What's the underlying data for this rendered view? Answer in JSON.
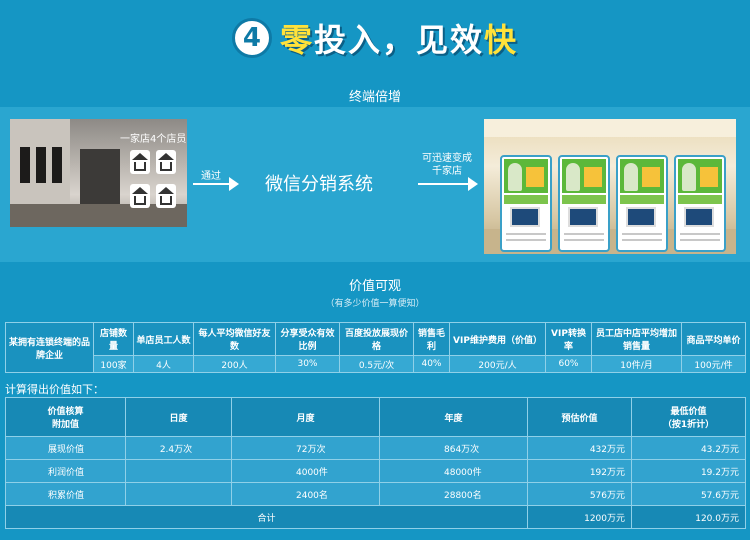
{
  "header": {
    "number": "4",
    "title_highlight": "零",
    "title_white": "投入，见效",
    "title_yellow": "快"
  },
  "sections": {
    "terminal_multiply": "终端倍增",
    "value_visible": "价值可观",
    "value_hint": "（有多少价值一算便知）"
  },
  "diagram": {
    "store_label": "一家店4个店员",
    "via_label": "通过",
    "system_label": "微信分销系统",
    "quick_label_line1": "可迅速变成",
    "quick_label_line2": "千家店"
  },
  "values_table": {
    "row_header": "某拥有连锁终端的品牌企业",
    "headers": [
      "店铺数量",
      "单店员工人数",
      "每人平均微信好友数",
      "分享受众有效比例",
      "百度投放展现价格",
      "销售毛利",
      "VIP维护费用（价值）",
      "VIP转换率",
      "员工店中店平均增加销售量",
      "商品平均单价"
    ],
    "values": [
      "100家",
      "4人",
      "200人",
      "30%",
      "0.5元/次",
      "40%",
      "200元/人",
      "60%",
      "10件/月",
      "100元/件"
    ]
  },
  "calc_title": "计算得出价值如下：",
  "calc_table": {
    "header_first_line1": "价值核算",
    "header_first_line2": "附加值",
    "headers": [
      "日度",
      "月度",
      "年度",
      "预估价值"
    ],
    "header_last_line1": "最低价值",
    "header_last_line2": "（按1折计）",
    "rows": [
      {
        "label": "展现价值",
        "daily": "2.4万次",
        "monthly": "72万次",
        "yearly": "864万次",
        "estimated": "432万元",
        "minimum": "43.2万元"
      },
      {
        "label": "利润价值",
        "daily": "",
        "monthly": "4000件",
        "yearly": "48000件",
        "estimated": "192万元",
        "minimum": "19.2万元"
      },
      {
        "label": "积累价值",
        "daily": "",
        "monthly": "2400名",
        "yearly": "28800名",
        "estimated": "576万元",
        "minimum": "57.6万元"
      }
    ],
    "total_label": "合计",
    "total_estimated": "1200万元",
    "total_minimum": "120.0万元"
  },
  "colors": {
    "background": "#1596c4",
    "band": "#2aa6d0",
    "title_yellow": "#ffe23a"
  }
}
